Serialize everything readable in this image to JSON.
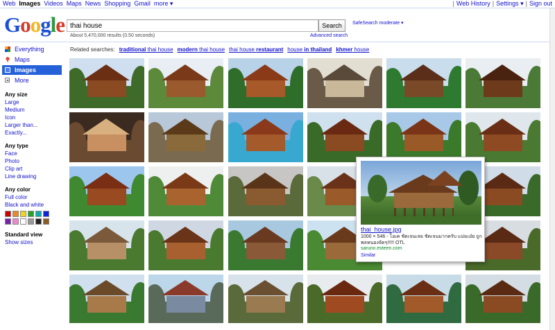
{
  "topbar": {
    "left": [
      "Web",
      "Images",
      "Videos",
      "Maps",
      "News",
      "Shopping",
      "Gmail",
      "more ▾"
    ],
    "active": "Images",
    "right": [
      "Web History",
      "Settings ▾",
      "Sign out"
    ]
  },
  "logo": {
    "parts": [
      "G",
      "o",
      "o",
      "g",
      "l",
      "e"
    ]
  },
  "search": {
    "query": "thai house",
    "button": "Search",
    "safesearch": "SafeSearch moderate ▾",
    "advanced": "Advanced search",
    "stats": "About 5,470,000 results (0.50 seconds)"
  },
  "nav": [
    {
      "label": "Everything",
      "icon": "everything-icon"
    },
    {
      "label": "Maps",
      "icon": "map-pin-icon"
    },
    {
      "label": "Images",
      "icon": "images-icon",
      "active": true
    },
    {
      "label": "More",
      "icon": "more-icon"
    }
  ],
  "filters": [
    {
      "title": "Any size",
      "links": [
        "Large",
        "Medium",
        "Icon",
        "Larger than...",
        "Exactly..."
      ]
    },
    {
      "title": "Any type",
      "links": [
        "Face",
        "Photo",
        "Clip art",
        "Line drawing"
      ]
    },
    {
      "title": "Any color",
      "links": [
        "Full color",
        "Black and white"
      ]
    }
  ],
  "swatches": [
    "#cc0000",
    "#ee8822",
    "#f2d51a",
    "#28a028",
    "#11aaaa",
    "#1122dd",
    "#7722aa",
    "#ee88cc",
    "#ffffff",
    "#999999",
    "#222222",
    "#8a5a2a"
  ],
  "view": {
    "title": "Standard view",
    "link": "Show sizes"
  },
  "related": {
    "label": "Related searches:",
    "items": [
      {
        "bold": "traditional",
        "rest": " thai house",
        "bold_first": true
      },
      {
        "bold": "modern",
        "rest": " thai house",
        "bold_first": true
      },
      {
        "bold": "restaurant",
        "rest": "thai house ",
        "bold_first": false
      },
      {
        "bold": "in thailand",
        "rest": "house ",
        "bold_first": false
      },
      {
        "bold": "khmer",
        "rest": " house",
        "bold_first": true
      }
    ]
  },
  "hover": {
    "title": "thai_house.jpg",
    "desc": "1000 × 546 - โอเค ชัดเจนเลย ชัดเจนมากครับ แม่มเอ๋ย ถูกพลหนองจัดๆ!!!!! OTL",
    "source": "saruno.exteen.com",
    "similar": "Similar"
  },
  "colors": {
    "link": "#1111cc",
    "active_nav": "#2561d9",
    "url": "#0a8a2a"
  },
  "thumbs": [
    {
      "sky": "#cfdff0",
      "ground": "#3f6b2a",
      "wall": "#8a4a22",
      "roof": "#6b2f14"
    },
    {
      "sky": "#e8eef3",
      "ground": "#5c8a3a",
      "wall": "#9a5a2e",
      "roof": "#7a3a1a"
    },
    {
      "sky": "#b8d2e8",
      "ground": "#2f6e2a",
      "wall": "#a8592a",
      "roof": "#8b3a18"
    },
    {
      "sky": "#e2ded2",
      "ground": "#6a5a48",
      "wall": "#c9b89a",
      "roof": "#5a4a3a"
    },
    {
      "sky": "#c9dded",
      "ground": "#2d7a30",
      "wall": "#7a4a28",
      "roof": "#5a2e18"
    },
    {
      "sky": "#e9eef2",
      "ground": "#4a7a36",
      "wall": "#6e3a1c",
      "roof": "#4a2210"
    },
    {
      "sky": "#3a2a20",
      "ground": "#6a4a30",
      "wall": "#c89060",
      "roof": "#d8b080"
    },
    {
      "sky": "#b8c8d8",
      "ground": "#7a6a50",
      "wall": "#8a6a3a",
      "roof": "#5a3a18"
    },
    {
      "sky": "#7ab0e0",
      "ground": "#38a8d0",
      "wall": "#a45a2a",
      "roof": "#8a3a1a"
    },
    {
      "sky": "#cfe0ee",
      "ground": "#3a6a28",
      "wall": "#8a4a22",
      "roof": "#6a2a12"
    },
    {
      "sky": "#a8c8e8",
      "ground": "#3a7a2a",
      "wall": "#9a5a28",
      "roof": "#7a3418"
    },
    {
      "sky": "#dfe6ec",
      "ground": "#4a7a32",
      "wall": "#8e4a22",
      "roof": "#6a2e14"
    },
    {
      "sky": "#9cc6ee",
      "ground": "#3f8a30",
      "wall": "#9a4a20",
      "roof": "#7a2e14"
    },
    {
      "sky": "#eef0f0",
      "ground": "#4f8a38",
      "wall": "#a8632e",
      "roof": "#7a3a18"
    },
    {
      "sky": "#c7c6c4",
      "ground": "#5a6a3a",
      "wall": "#8a5a30",
      "roof": "#5a3418"
    },
    {
      "sky": "#d8e0e8",
      "ground": "#6a8a4a",
      "wall": "#9a5a2a",
      "roof": "#6a3218"
    },
    {
      "sky": "#c8d8e6",
      "ground": "#3a6a2a",
      "wall": "#9a5428",
      "roof": "#6a2e14"
    },
    {
      "sky": "#d0dce8",
      "ground": "#3a6a2a",
      "wall": "#8a4a22",
      "roof": "#5a2a14"
    },
    {
      "sky": "#d8e4ec",
      "ground": "#4a7a30",
      "wall": "#b89068",
      "roof": "#7a5a3a"
    },
    {
      "sky": "#cfd8e2",
      "ground": "#4a7a30",
      "wall": "#a86030",
      "roof": "#6a3418"
    },
    {
      "sky": "#a8c8e0",
      "ground": "#3a7a30",
      "wall": "#8a5a38",
      "roof": "#6a3a20"
    },
    {
      "sky": "#cde2f0",
      "ground": "#4a8a32",
      "wall": "#9a6a3a",
      "roof": "#6a3a1c"
    },
    {
      "sky": "#e0e6ea",
      "ground": "#5a7a3a",
      "wall": "#8a4a22",
      "roof": "#5a2e14"
    },
    {
      "sky": "#d8dde2",
      "ground": "#4a6a2a",
      "wall": "#8a4a28",
      "roof": "#5a2a14"
    },
    {
      "sky": "#d0e0ee",
      "ground": "#3a7a30",
      "wall": "#a87a4a",
      "roof": "#6a4a28"
    },
    {
      "sky": "#bcd6ea",
      "ground": "#5a6a5a",
      "wall": "#7a8aa0",
      "roof": "#8a3a2a"
    },
    {
      "sky": "#d8e2ea",
      "ground": "#5a6a3a",
      "wall": "#9a7a50",
      "roof": "#6a5030"
    },
    {
      "sky": "#e8ecef",
      "ground": "#4a6a2a",
      "wall": "#a04a22",
      "roof": "#6a2810"
    },
    {
      "sky": "#c8dce8",
      "ground": "#2f6a40",
      "wall": "#a25a2a",
      "roof": "#6a2e14"
    },
    {
      "sky": "#d4dde4",
      "ground": "#3a6a2a",
      "wall": "#8a4a22",
      "roof": "#5a2a12"
    }
  ]
}
